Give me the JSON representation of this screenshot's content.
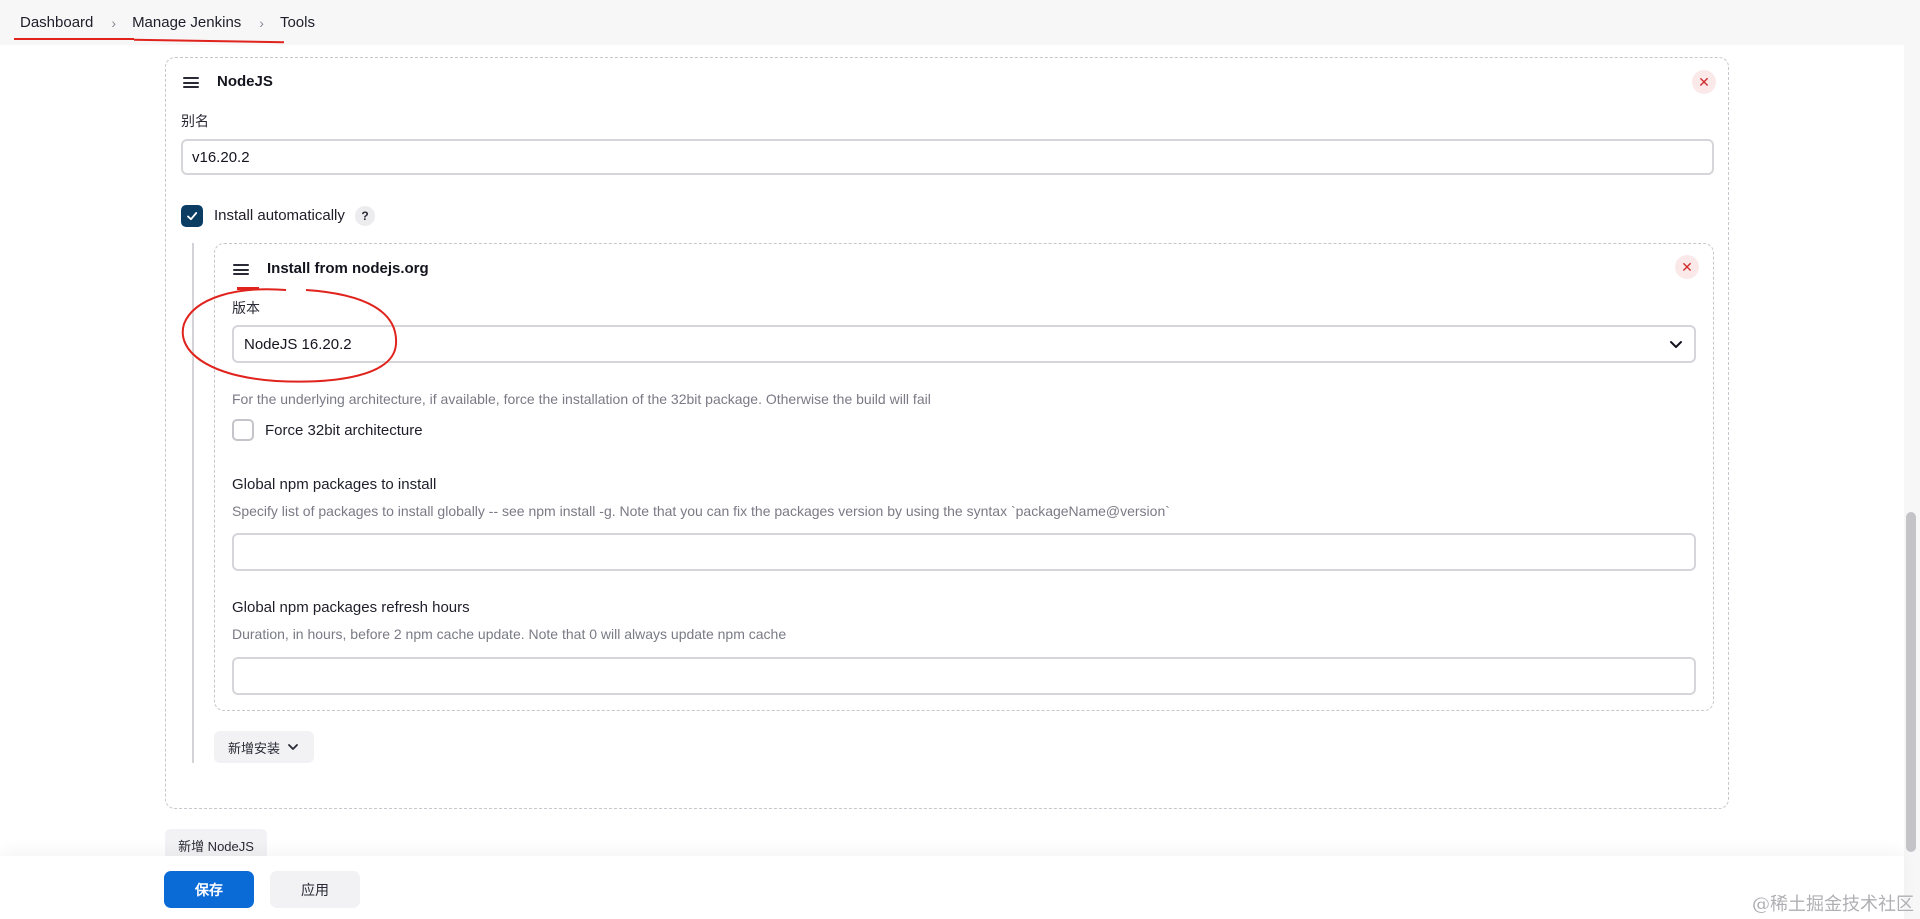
{
  "breadcrumb": {
    "items": [
      "Dashboard",
      "Manage Jenkins",
      "Tools"
    ]
  },
  "nodejs_card": {
    "title": "NodeJS",
    "alias_label": "别名",
    "alias_value": "v16.20.2",
    "install_auto_label": "Install automatically",
    "install_auto_checked": true,
    "help_label": "?"
  },
  "installer_card": {
    "title": "Install from nodejs.org",
    "version_label": "版本",
    "version_selected": "NodeJS 16.20.2",
    "arch_description": "For the underlying architecture, if available, force the installation of the 32bit package. Otherwise the build will fail",
    "force32_label": "Force 32bit architecture",
    "force32_checked": false,
    "npm_packages_label": "Global npm packages to install",
    "npm_packages_description": "Specify list of packages to install globally -- see npm install -g. Note that you can fix the packages version by using the syntax `packageName@version`",
    "npm_packages_value": "",
    "npm_refresh_label": "Global npm packages refresh hours",
    "npm_refresh_description": "Duration, in hours, before 2 npm cache update. Note that 0 will always update npm cache",
    "npm_refresh_value": ""
  },
  "add_installer_label": "新增安装",
  "add_nodejs_label": "新增 NodeJS",
  "actions": {
    "save_label": "保存",
    "apply_label": "应用"
  },
  "watermark": "@稀土掘金技术社区",
  "colors": {
    "primary": "#0b6bd6",
    "checkbox_checked": "#0b3d63",
    "annotation_red": "#e0231c",
    "close_red": "#d12b2b"
  }
}
